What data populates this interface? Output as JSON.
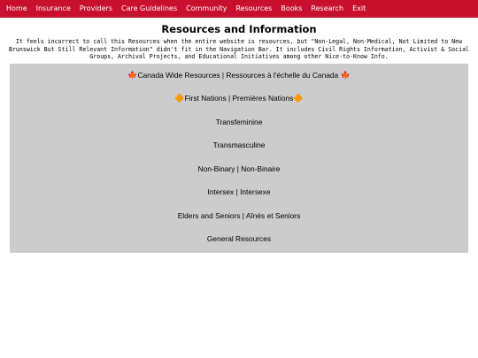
{
  "nav": {
    "items": [
      {
        "label": "Home"
      },
      {
        "label": "Insurance"
      },
      {
        "label": "Providers"
      },
      {
        "label": "Care Guidelines"
      },
      {
        "label": "Community"
      },
      {
        "label": "Resources"
      },
      {
        "label": "Books"
      },
      {
        "label": "Research"
      },
      {
        "label": "Exit"
      }
    ]
  },
  "page": {
    "title": "Resources and Information",
    "intro": "It feels incorrect to call this Resources when the entire website is resources, but \"Non-Legal, Non-Medical, Not Limited to New Brunswick But Still Relevant Information\" didn't fit in the Navigation Bar. It includes Civil Rights Information, Activist & Social Groups, Archival Projects, and Educational Initiatives among other Nice-to-Know Info."
  },
  "links": {
    "canada_wide": "Canada Wide Resources | Ressources à l'échelle du Canada",
    "first_nations": "First Nations | Premières Nations",
    "transfeminine": "Transfeminine",
    "transmasculine": "Transmasculine",
    "nonbinary": "Non-Binary | Non-Binaire",
    "intersex": "Intersex | Intersexe",
    "elders": "Elders and Seniors | Aînés et Seniors",
    "general": "General Resources"
  },
  "icons": {
    "leaf": "🍁",
    "diamond": "🔶"
  },
  "colors": {
    "nav_background": "#c8102e",
    "panel_background": "#cccccc"
  }
}
